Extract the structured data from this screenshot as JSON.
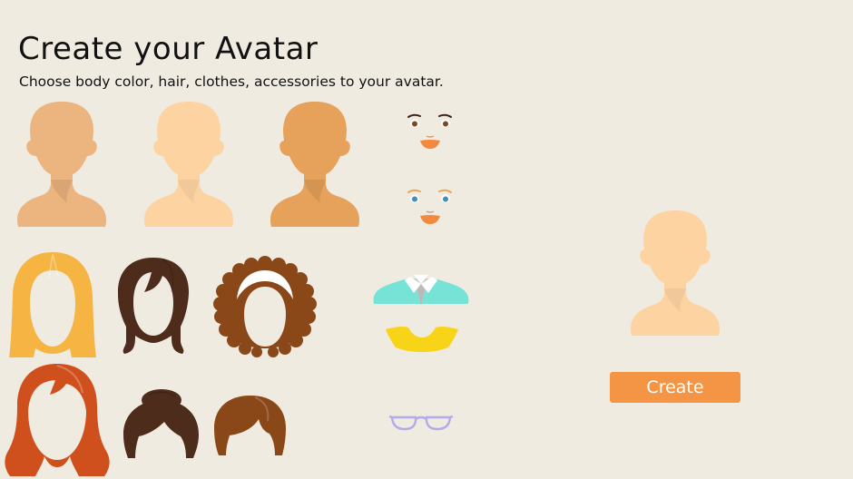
{
  "header": {
    "title": "Create your Avatar",
    "subtitle": "Choose body color, hair, clothes, accessories to your avatar."
  },
  "body_colors": [
    "#ecb47f",
    "#fdd3a2",
    "#e6a15a"
  ],
  "eyes_options": [
    {
      "iris_color": "#7a4a21",
      "mouth_color": "#f3883f"
    },
    {
      "iris_color": "#3c8fbf",
      "mouth_color": "#f3883f"
    }
  ],
  "hair_colors": [
    "#f6b443",
    "#4e2c1c",
    "#8a4718",
    "#d0501d",
    "#4e2c1c",
    "#8a4718"
  ],
  "clothes_colors": [
    "#77e2d6",
    "#f8d419"
  ],
  "glasses_color": "#b3aaec",
  "preview": {
    "body_color": "#fdd3a2"
  },
  "actions": {
    "create_label": "Create"
  }
}
